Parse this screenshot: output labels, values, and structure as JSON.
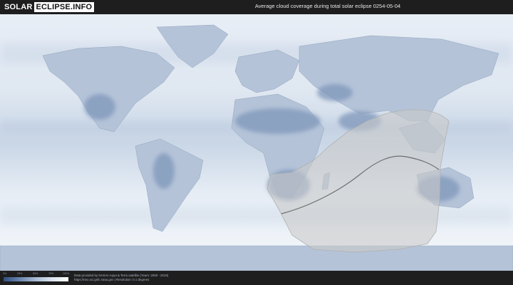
{
  "header": {
    "logo_left": "SOLAR",
    "logo_right": "ECLIPSE.INFO",
    "title": "Average cloud coverage during total solar eclipse 0254-05-04"
  },
  "map": {
    "background_color": "#e9eef5",
    "land_color": "#b7c6da",
    "dark_cloud_color": "#7f97ba",
    "eclipse_zone_color": "#d0d0d0",
    "path_line_color": "#6e6e6e"
  },
  "footer": {
    "legend_ticks": [
      "0%",
      "25%",
      "50%",
      "75%",
      "100%"
    ],
    "credit_line1": "Data provided by NASAs Aqua & Terra satellite (Years: 2000 - 2019)",
    "credit_line2": "https://neo.sci.gsfc.nasa.gov | Resolution: 0.1 degrees"
  }
}
